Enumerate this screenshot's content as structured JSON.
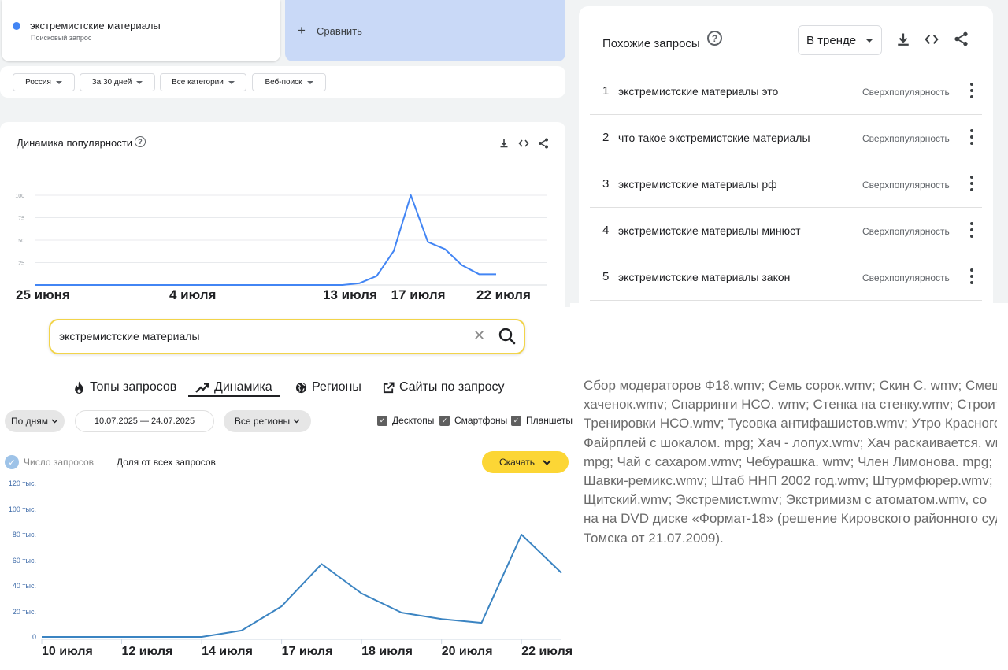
{
  "google_trends": {
    "term": {
      "title": "экстремистские материалы",
      "subtitle": "Поисковый запрос"
    },
    "compare": {
      "label": "Сравнить"
    },
    "filters": [
      "Россия",
      "За 30 дней",
      "Все категории",
      "Веб-поиск"
    ],
    "dynamics_title": "Динамика популярности",
    "help_glyph": "?",
    "icons": {
      "download": "download-icon",
      "embed": "code-icon",
      "share": "share-icon",
      "help": "help-icon"
    }
  },
  "related_queries": {
    "title": "Похожие запросы",
    "select_value": "В тренде",
    "items": [
      {
        "rank": "1",
        "query": "экстремистские материалы это",
        "badge": "Сверхпопулярность"
      },
      {
        "rank": "2",
        "query": "что такое экстремистские материалы",
        "badge": "Сверхпопулярность"
      },
      {
        "rank": "3",
        "query": "экстремистские материалы рф",
        "badge": "Сверхпопулярность"
      },
      {
        "rank": "4",
        "query": "экстремистские материалы минюст",
        "badge": "Сверхпопулярность"
      },
      {
        "rank": "5",
        "query": "экстремистские материалы закон",
        "badge": "Сверхпопулярность"
      }
    ]
  },
  "yandex_wordstat": {
    "search_value": "экстремистские материалы",
    "clear_glyph": "✕",
    "tabs": [
      {
        "label": "Топы запросов",
        "icon": "flame-icon"
      },
      {
        "label": "Динамика",
        "icon": "trend-icon",
        "active": true
      },
      {
        "label": "Регионы",
        "icon": "globe-icon"
      },
      {
        "label": "Сайты по запросу",
        "icon": "external-link-icon"
      }
    ],
    "period": "По дням",
    "date_range": "10.07.2025 — 24.07.2025",
    "regions": "Все регионы",
    "devices": [
      {
        "label": "Десктопы",
        "checked": true
      },
      {
        "label": "Смартфоны",
        "checked": true
      },
      {
        "label": "Планшеты",
        "checked": true
      }
    ],
    "metric_selected": "Число запросов",
    "metric_other": "Доля от всех запросов",
    "download_label": "Скачать"
  },
  "document_text": {
    "lines": [
      "Сбор модераторов Ф18.wmv; Семь сорок.wmv; Скин С. wmv; Смеш",
      "хаченок.wmv; Спарринги НСО. wmv; Стенка на стенку.wmv; Строит",
      "Тренировки НСО.wmv; Тусовка антифашистов.wmv; Утро Красного",
      "Файрплей с шокалом. mpg; Хач - лопух.wmv; Хач раскаивается. wr",
      "mpg; Чай с сахаром.wmv; Чебурашка. wmv; Член Лимонова. mpg;",
      "Шавки-ремикс.wmv; Штаб ННП 2002 год.wmv; Штурмфюрер.wmv;",
      "Щитский.wmv; Экстремист.wmv; Экстримизм с атоматом.wmv, со",
      "на на DVD диске «Формат-18» (решение Кировского районного суд",
      "Томска от 21.07.2009)."
    ]
  },
  "chart_data": [
    {
      "type": "line",
      "title": "Динамика популярности",
      "y_ticks": [
        "100",
        "75",
        "50",
        "25"
      ],
      "ylim": [
        0,
        100
      ],
      "x_tick_labels": [
        "25 июня",
        "4 июля",
        "13 июля",
        "17 июля",
        "22 июля"
      ],
      "x_tick_days": [
        0,
        9,
        18,
        22,
        27
      ],
      "x_day_range": [
        0,
        30
      ],
      "series": [
        {
          "color": "#4285f4",
          "x": [
            0,
            1,
            2,
            3,
            4,
            5,
            6,
            7,
            8,
            9,
            10,
            11,
            12,
            13,
            14,
            15,
            16,
            17,
            18,
            19,
            20,
            21,
            22,
            23,
            24,
            25,
            26,
            27
          ],
          "y": [
            0,
            0,
            0,
            0,
            0,
            0,
            0,
            0,
            0,
            0,
            0,
            0,
            0,
            0,
            0,
            0,
            0,
            0,
            0,
            2,
            10,
            38,
            100,
            48,
            40,
            22,
            12,
            12
          ]
        }
      ],
      "grid": true
    },
    {
      "type": "line",
      "y_ticks": [
        "120 тыс.",
        "100 тыс.",
        "80 тыс.",
        "60 тыс.",
        "40 тыс.",
        "20 тыс.",
        "0"
      ],
      "ylim": [
        0,
        120000
      ],
      "x_tick_labels": [
        "10 июля",
        "12 июля",
        "14 июля",
        "17 июля",
        "18 июля",
        "20 июля",
        "22 июля"
      ],
      "x_tick_days": [
        0,
        2,
        4,
        6,
        8,
        10,
        12
      ],
      "x_day_range": [
        0,
        13
      ],
      "series": [
        {
          "color": "#3b84c2",
          "x": [
            0,
            1,
            2,
            3,
            4,
            5,
            6,
            7,
            8,
            9,
            10,
            11,
            12,
            13
          ],
          "y": [
            0,
            0,
            0,
            0,
            0,
            5000,
            24000,
            57000,
            34000,
            19000,
            14000,
            11000,
            80000,
            50000
          ]
        }
      ]
    }
  ],
  "colors": {
    "google_blue": "#4285f4",
    "yandex_yellow": "#fcd635",
    "compare_bg": "#c9d9f7"
  }
}
